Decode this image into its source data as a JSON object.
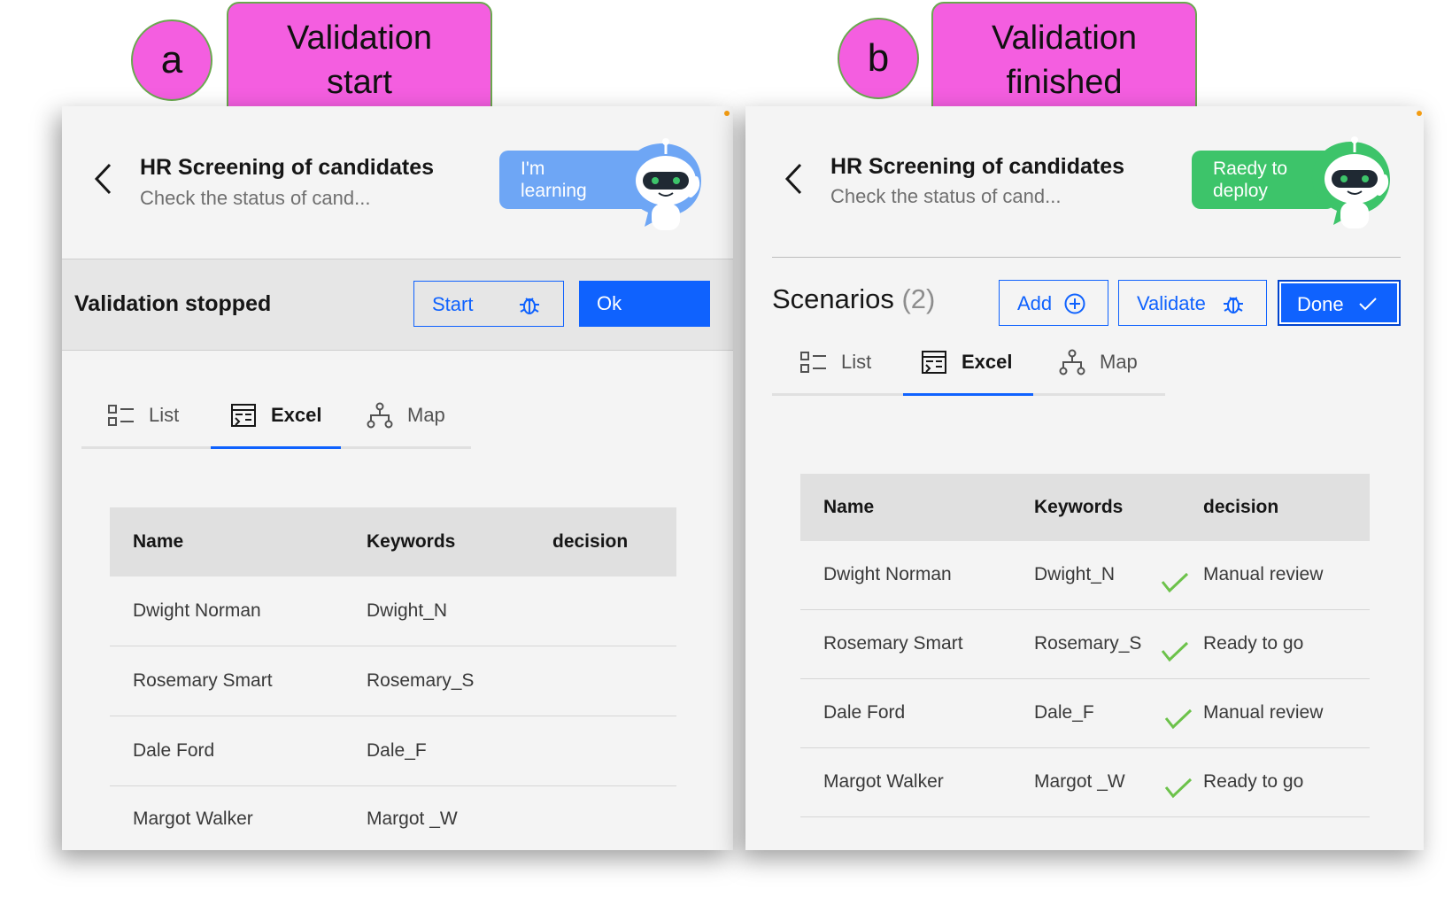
{
  "panel_a": {
    "tag_letter": "a",
    "tag_text": "Validation\nstart",
    "header": {
      "title": "HR Screening of candidates",
      "subtitle": "Check the status of cand..."
    },
    "bubble": {
      "text": "I'm\nlearning",
      "color": "#6ea6f5"
    },
    "status": {
      "text": "Validation stopped",
      "start_label": "Start",
      "ok_label": "Ok"
    },
    "tabs": [
      {
        "label": "List",
        "active": false
      },
      {
        "label": "Excel",
        "active": true
      },
      {
        "label": "Map",
        "active": false
      }
    ],
    "table": {
      "headers": [
        "Name",
        "Keywords",
        "decision"
      ],
      "rows": [
        {
          "name": "Dwight Norman",
          "keywords": "Dwight_N",
          "decision": ""
        },
        {
          "name": "Rosemary Smart",
          "keywords": "Rosemary_S",
          "decision": ""
        },
        {
          "name": "Dale Ford",
          "keywords": "Dale_F",
          "decision": ""
        },
        {
          "name": "Margot Walker",
          "keywords": "Margot _W",
          "decision": ""
        }
      ]
    }
  },
  "panel_b": {
    "tag_letter": "b",
    "tag_text": "Validation\nfinished",
    "header": {
      "title": "HR Screening of candidates",
      "subtitle": "Check the status of cand..."
    },
    "bubble": {
      "text": "Raedy to\ndeploy",
      "color": "#3dc46a"
    },
    "scenarios": {
      "label": "Scenarios",
      "count": "(2)",
      "add_label": "Add",
      "validate_label": "Validate",
      "done_label": "Done"
    },
    "tabs": [
      {
        "label": "List",
        "active": false
      },
      {
        "label": "Excel",
        "active": true
      },
      {
        "label": "Map",
        "active": false
      }
    ],
    "table": {
      "headers": [
        "Name",
        "Keywords",
        "decision"
      ],
      "rows": [
        {
          "name": "Dwight Norman",
          "keywords": "Dwight_N",
          "decision": "Manual review",
          "checked": true
        },
        {
          "name": "Rosemary Smart",
          "keywords": "Rosemary_S",
          "decision": "Ready to go",
          "checked": true
        },
        {
          "name": "Dale Ford",
          "keywords": "Dale_F",
          "decision": "Manual review",
          "checked": true
        },
        {
          "name": "Margot Walker",
          "keywords": "Margot _W",
          "decision": "Ready to go",
          "checked": true
        }
      ]
    }
  },
  "colors": {
    "tag": "#f45ee0",
    "tag_border": "#6aa84f",
    "primary": "#0f62fe",
    "check": "#6cc24a"
  },
  "icons": [
    "chevron-left-icon",
    "robot-icon",
    "bug-icon",
    "add-circle-icon",
    "checkmark-icon",
    "list-icon",
    "excel-icon",
    "map-icon"
  ]
}
